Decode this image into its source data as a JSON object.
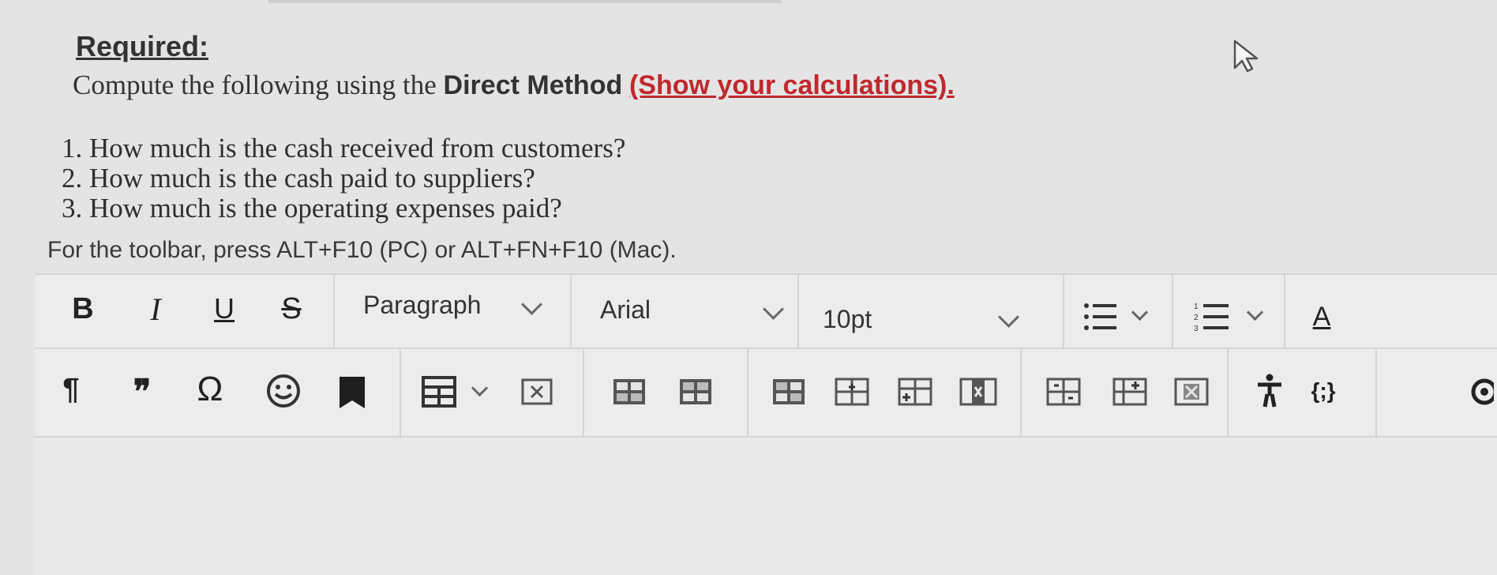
{
  "heading": "Required:",
  "intro": {
    "prefix": "Compute the following using the",
    "method": "Direct Method",
    "note": "(Show your calculations)."
  },
  "questions": [
    "1. How much is the cash received from customers?",
    "2. How much is the cash paid to suppliers?",
    "3. How much is the operating expenses paid?"
  ],
  "toolbar_hint": "For the toolbar, press ALT+F10 (PC) or ALT+FN+F10 (Mac).",
  "toolbar": {
    "bold": "B",
    "italic": "I",
    "underline": "U",
    "strikethrough": "S",
    "block_format": "Paragraph",
    "font_family": "Arial",
    "font_size": "10pt",
    "paragraph_mark": "¶",
    "blockquote": "❞",
    "special_char": "Ω",
    "source_code": "{;}",
    "text_color_label": "A"
  },
  "colors": {
    "accent_red": "#c0282d",
    "text": "#2a2a2a",
    "toolbar_bg": "#ececec"
  },
  "icons": [
    "bullet-list-icon",
    "numbered-list-icon",
    "paragraph-icon",
    "blockquote-icon",
    "omega-icon",
    "emoji-icon",
    "bookmark-icon",
    "table-icon",
    "remove-format-icon",
    "table-insert-row-before-icon",
    "table-insert-row-after-icon",
    "table-delete-row-icon",
    "table-insert-col-before-icon",
    "table-insert-col-after-icon",
    "table-delete-col-icon",
    "table-cell-split-icon",
    "table-merge-icon",
    "table-delete-icon",
    "accessibility-icon",
    "source-code-icon",
    "preview-icon"
  ]
}
